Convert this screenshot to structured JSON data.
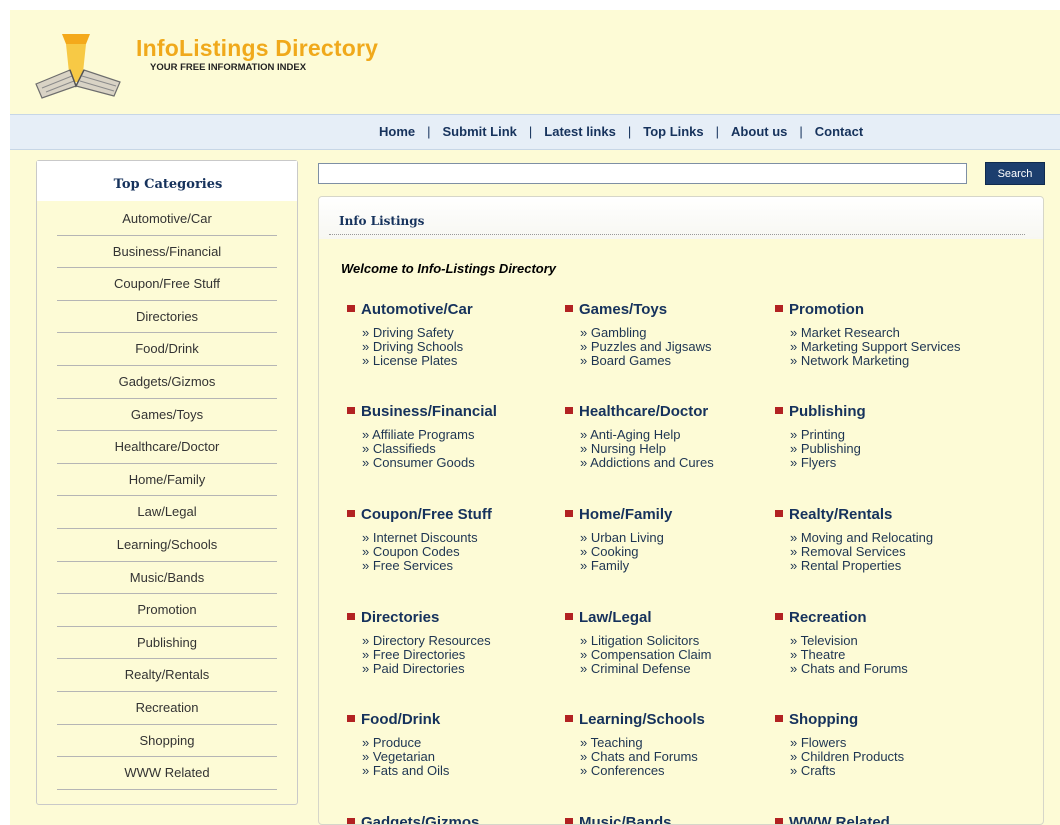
{
  "header": {
    "title": "InfoListings Directory",
    "tagline": "YOUR FREE INFORMATION INDEX"
  },
  "nav": {
    "links": [
      "Home",
      "Submit Link",
      "Latest links",
      "Top Links",
      "About us",
      "Contact"
    ],
    "separator": "|"
  },
  "search": {
    "value": "",
    "button_label": "Search"
  },
  "sidebar": {
    "title": "Top Categories",
    "items": [
      "Automotive/Car",
      "Business/Financial",
      "Coupon/Free Stuff",
      "Directories",
      "Food/Drink",
      "Gadgets/Gizmos",
      "Games/Toys",
      "Healthcare/Doctor",
      "Home/Family",
      "Law/Legal",
      "Learning/Schools",
      "Music/Bands",
      "Promotion",
      "Publishing",
      "Realty/Rentals",
      "Recreation",
      "Shopping",
      "WWW Related"
    ]
  },
  "main": {
    "title": "Info Listings",
    "welcome": "Welcome to Info-Listings Directory",
    "categories": [
      {
        "title": "Automotive/Car",
        "subs": [
          "» Driving Safety",
          "» Driving Schools",
          "» License Plates"
        ]
      },
      {
        "title": "Games/Toys",
        "subs": [
          "» Gambling",
          "» Puzzles and Jigsaws",
          "» Board Games"
        ]
      },
      {
        "title": "Promotion",
        "subs": [
          "» Market Research",
          "» Marketing Support Services",
          "» Network Marketing"
        ]
      },
      {
        "title": "Business/Financial",
        "subs": [
          "» Affiliate Programs",
          "» Classifieds",
          "» Consumer Goods"
        ]
      },
      {
        "title": "Healthcare/Doctor",
        "subs": [
          "» Anti-Aging Help",
          "» Nursing Help",
          "» Addictions and Cures"
        ]
      },
      {
        "title": "Publishing",
        "subs": [
          "» Printing",
          "» Publishing",
          "» Flyers"
        ]
      },
      {
        "title": "Coupon/Free Stuff",
        "subs": [
          "» Internet Discounts",
          "» Coupon Codes",
          "» Free Services"
        ]
      },
      {
        "title": "Home/Family",
        "subs": [
          "» Urban Living",
          "» Cooking",
          "» Family"
        ]
      },
      {
        "title": "Realty/Rentals",
        "subs": [
          "» Moving and Relocating",
          "» Removal Services",
          "» Rental Properties"
        ]
      },
      {
        "title": "Directories",
        "subs": [
          "» Directory Resources",
          "» Free Directories",
          "» Paid Directories"
        ]
      },
      {
        "title": "Law/Legal",
        "subs": [
          "» Litigation Solicitors",
          "» Compensation Claim",
          "» Criminal Defense"
        ]
      },
      {
        "title": "Recreation",
        "subs": [
          "» Television",
          "» Theatre",
          "» Chats and Forums"
        ]
      },
      {
        "title": "Food/Drink",
        "subs": [
          "» Produce",
          "» Vegetarian",
          "» Fats and Oils"
        ]
      },
      {
        "title": "Learning/Schools",
        "subs": [
          "» Teaching",
          "» Chats and Forums",
          "» Conferences"
        ]
      },
      {
        "title": "Shopping",
        "subs": [
          "» Flowers",
          "» Children Products",
          "» Crafts"
        ]
      },
      {
        "title": "Gadgets/Gizmos",
        "subs": []
      },
      {
        "title": "Music/Bands",
        "subs": []
      },
      {
        "title": "WWW Related",
        "subs": []
      }
    ]
  },
  "colors": {
    "background": "#fdfbd6",
    "navbar": "#e6eef7",
    "link": "#16325c",
    "logo_text": "#f0a91b",
    "bullet": "#b22222",
    "search_button": "#1c3e6e"
  },
  "icons": {
    "logo": "open-book-lamp-icon",
    "category_bullet": "square-bullet-icon"
  }
}
